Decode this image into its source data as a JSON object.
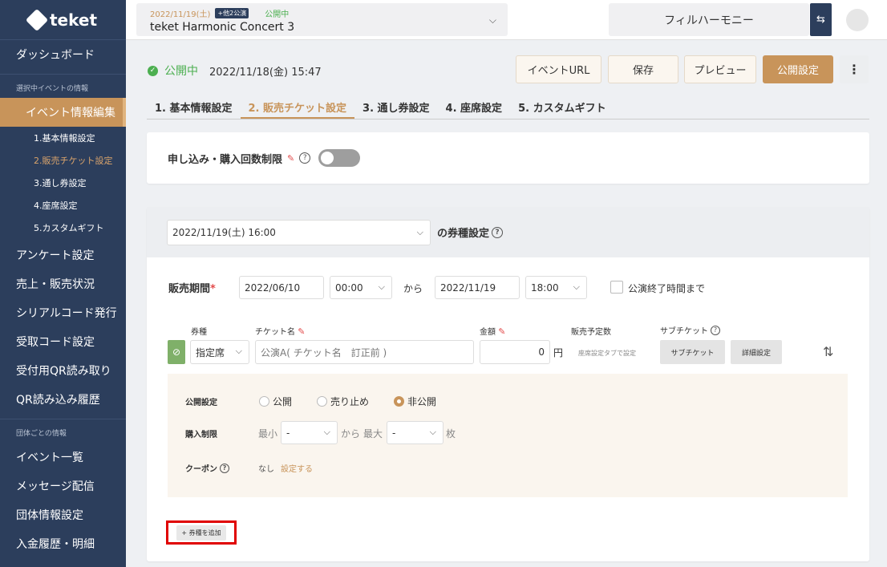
{
  "sidebar": {
    "logo": "teket",
    "dashboard": "ダッシュボード",
    "section_selected": "選択中イベントの情報",
    "event_edit": "イベント情報編集",
    "sub_items": [
      "1.基本情報設定",
      "2.販売チケット設定",
      "3.通し券設定",
      "4.座席設定",
      "5.カスタムギフト"
    ],
    "main_items": [
      "アンケート設定",
      "売上・販売状況",
      "シリアルコード発行",
      "受取コード設定",
      "受付用QR読み取り",
      "QR読み込み履歴"
    ],
    "section_org": "団体ごとの情報",
    "org_items": [
      "イベント一覧",
      "メッセージ配信",
      "団体情報設定",
      "入金履歴・明細"
    ]
  },
  "topbar": {
    "event_date": "2022/11/19(土)",
    "event_badge": "+他2公演",
    "event_status": "公開中",
    "event_title": "teket Harmonic Concert 3",
    "org_name": "フィルハーモニー",
    "swap_icon": "⇆"
  },
  "status": {
    "label": "公開中",
    "datetime": "2022/11/18(金) 15:47"
  },
  "actions": {
    "event_url": "イベントURL",
    "save": "保存",
    "preview": "プレビュー",
    "publish": "公開設定",
    "more": "⋮"
  },
  "tabs": [
    "1. 基本情報設定",
    "2. 販売チケット設定",
    "3. 通し券設定",
    "4. 座席設定",
    "5. カスタムギフト"
  ],
  "limit_panel": {
    "label": "申し込み・購入回数制限",
    "help": "?"
  },
  "ticket_panel": {
    "date": "2022/11/19(土) 16:00",
    "head_label": "の券種設定",
    "sales_period_label": "販売期間",
    "required_mark": "*",
    "start_date": "2022/06/10",
    "start_time": "00:00",
    "from": "から",
    "end_date": "2022/11/19",
    "end_time": "18:00",
    "until_end_label": "公演終了時間まで",
    "cols": {
      "type": "券種",
      "name": "チケット名",
      "price": "金額",
      "qty": "販売予定数",
      "sub": "サブチケット"
    },
    "type_value": "指定席",
    "name_value": "公演A( チケット名　訂正前 )",
    "price_value": "0",
    "yen": "円",
    "qty_note": "座席設定タブで設定",
    "sub_btn": "サブチケット",
    "detail_btn": "詳細設定",
    "sort_icon": "⇅",
    "publish_label": "公開設定",
    "publish_options": [
      "公開",
      "売り止め",
      "非公開"
    ],
    "purchase_limit_label": "購入制限",
    "min_label": "最小",
    "min_value": "-",
    "range_from": "から",
    "max_label": "最大",
    "max_value": "-",
    "unit": "枚",
    "coupon_label": "クーポン",
    "coupon_none": "なし",
    "coupon_set": "設定する",
    "add_ticket": "+ 券種を追加"
  }
}
